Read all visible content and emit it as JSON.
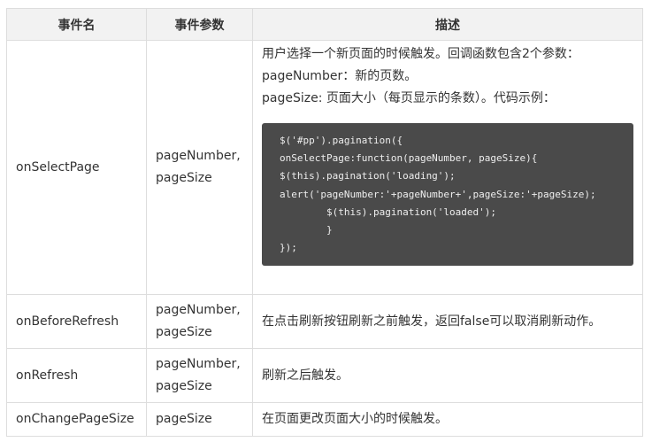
{
  "table": {
    "headers": [
      "事件名",
      "事件参数",
      "描述"
    ],
    "row1": {
      "name": "onSelectPage",
      "params": [
        "pageNumber,",
        "pageSize"
      ],
      "desc": [
        "用户选择一个新页面的时候触发。回调函数包含2个参数：",
        "pageNumber：新的页数。",
        "pageSize: 页面大小（每页显示的条数）。代码示例："
      ],
      "code": [
        "$('#pp').pagination({",
        "onSelectPage:function(pageNumber, pageSize){",
        "$(this).pagination('loading');",
        "alert('pageNumber:'+pageNumber+',pageSize:'+pageSize);",
        "        $(this).pagination('loaded');",
        "        }",
        "});"
      ]
    },
    "row2": {
      "name": "onBeforeRefresh",
      "params": [
        "pageNumber,",
        "pageSize"
      ],
      "desc": "在点击刷新按钮刷新之前触发，返回false可以取消刷新动作。"
    },
    "row3": {
      "name": "onRefresh",
      "params": [
        "pageNumber,",
        "pageSize"
      ],
      "desc": "刷新之后触发。"
    },
    "row4": {
      "name": "onChangePageSize",
      "params": [
        "pageSize"
      ],
      "desc": "在页面更改页面大小的时候触发。"
    }
  }
}
